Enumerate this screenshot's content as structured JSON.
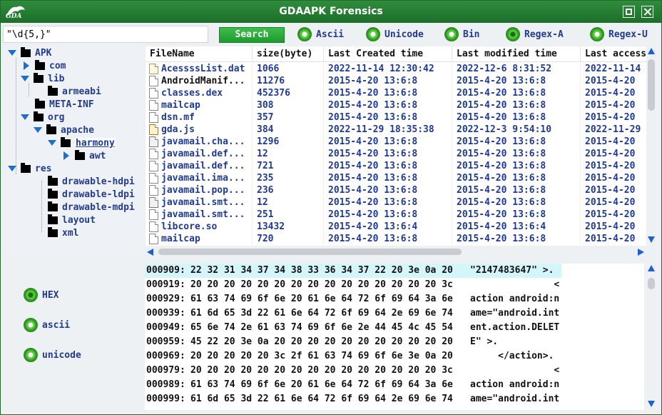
{
  "window": {
    "title": "GDAAPK Forensics",
    "logo_text": "GDA"
  },
  "search": {
    "value": "\"\\d{5,}\"",
    "button_label": "Search"
  },
  "encodings": [
    {
      "label": "Ascii",
      "checked": false
    },
    {
      "label": "Unicode",
      "checked": false
    },
    {
      "label": "Bin",
      "checked": false
    },
    {
      "label": "Regex-A",
      "checked": true
    },
    {
      "label": "Regex-U",
      "checked": false
    }
  ],
  "tree": {
    "apk": "APK",
    "com": "com",
    "lib": "lib",
    "armeabi": "armeabi",
    "meta_inf": "META-INF",
    "org": "org",
    "apache": "apache",
    "harmony": "harmony",
    "awt": "awt",
    "res": "res",
    "drawable_hdpi": "drawable-hdpi",
    "drawable_ldpi": "drawable-ldpi",
    "drawable_mdpi": "drawable-mdpi",
    "layout": "layout",
    "xml": "xml"
  },
  "filelist": {
    "headers": [
      "FileName",
      "size(byte)",
      "Last Created time",
      "Last modified time",
      "Last access"
    ],
    "rows": [
      [
        "AcessssList.dat",
        "1066",
        "2022-11-14 12:30:42",
        "2022-12-6 8:31:52",
        "2022-11-14"
      ],
      [
        "AndroidManif...",
        "11276",
        "2015-4-20 13:6:8",
        "2015-4-20 13:6:8",
        "2015-4-20"
      ],
      [
        "classes.dex",
        "452376",
        "2015-4-20 13:6:8",
        "2015-4-20 13:6:8",
        "2015-4-20"
      ],
      [
        "mailcap",
        "308",
        "2015-4-20 13:6:8",
        "2015-4-20 13:6:8",
        "2015-4-20"
      ],
      [
        "dsn.mf",
        "357",
        "2015-4-20 13:6:8",
        "2015-4-20 13:6:8",
        "2015-4-20"
      ],
      [
        "gda.js",
        "384",
        "2022-11-29 18:35:38",
        "2022-12-3 9:54:10",
        "2022-11-29"
      ],
      [
        "javamail.cha...",
        "1296",
        "2015-4-20 13:6:8",
        "2015-4-20 13:6:8",
        "2015-4-20"
      ],
      [
        "javamail.def...",
        "12",
        "2015-4-20 13:6:8",
        "2015-4-20 13:6:8",
        "2015-4-20"
      ],
      [
        "javamail.def...",
        "721",
        "2015-4-20 13:6:8",
        "2015-4-20 13:6:8",
        "2015-4-20"
      ],
      [
        "javamail.ima...",
        "235",
        "2015-4-20 13:6:8",
        "2015-4-20 13:6:8",
        "2015-4-20"
      ],
      [
        "javamail.pop...",
        "236",
        "2015-4-20 13:6:8",
        "2015-4-20 13:6:8",
        "2015-4-20"
      ],
      [
        "javamail.smt...",
        "12",
        "2015-4-20 13:6:8",
        "2015-4-20 13:6:8",
        "2015-4-20"
      ],
      [
        "javamail.smt...",
        "251",
        "2015-4-20 13:6:8",
        "2015-4-20 13:6:8",
        "2015-4-20"
      ],
      [
        "libcore.so",
        "13432",
        "2015-4-20 13:6:4",
        "2015-4-20 13:6:4",
        "2015-4-20"
      ],
      [
        "mailcap",
        "720",
        "2015-4-20 13:6:8",
        "2015-4-20 13:6:8",
        "2015-4-20"
      ]
    ],
    "row_icons": [
      "dat",
      "xml",
      "file",
      "file",
      "file",
      "js",
      "cfg",
      "file",
      "file",
      "file",
      "file",
      "cfg",
      "file",
      "file",
      "file"
    ]
  },
  "modes": [
    {
      "label": "HEX",
      "checked": true
    },
    {
      "label": "ascii",
      "checked": false
    },
    {
      "label": "unicode",
      "checked": false
    }
  ],
  "hex": {
    "rows": [
      {
        "offset": "000909:",
        "bytes": "22 32 31 34 37 34 38 33 36 34 37 22 20 3e 0a 20",
        "ascii": "\"2147483647\" >.",
        "highlight": true
      },
      {
        "offset": "000919:",
        "bytes": "20 20 20 20 20 20 20 20 20 20 20 20 20 20 20 3c",
        "ascii": "               <",
        "highlight": false
      },
      {
        "offset": "000929:",
        "bytes": "61 63 74 69 6f 6e 20 61 6e 64 72 6f 69 64 3a 6e",
        "ascii": "action android:n",
        "highlight": false
      },
      {
        "offset": "000939:",
        "bytes": "61 6d 65 3d 22 61 6e 64 72 6f 69 64 2e 69 6e 74",
        "ascii": "ame=\"android.int",
        "highlight": false
      },
      {
        "offset": "000949:",
        "bytes": "65 6e 74 2e 61 63 74 69 6f 6e 2e 44 45 4c 45 54",
        "ascii": "ent.action.DELET",
        "highlight": false
      },
      {
        "offset": "000959:",
        "bytes": "45 22 20 3e 0a 20 20 20 20 20 20 20 20 20 20 20",
        "ascii": "E\" >.",
        "highlight": false
      },
      {
        "offset": "000969:",
        "bytes": "20 20 20 20 20 3c 2f 61 63 74 69 6f 6e 3e 0a 20",
        "ascii": "     </action>.",
        "highlight": false
      },
      {
        "offset": "000979:",
        "bytes": "20 20 20 20 20 20 20 20 20 20 20 20 20 20 20 3c",
        "ascii": "               <",
        "highlight": false
      },
      {
        "offset": "000989:",
        "bytes": "61 63 74 69 6f 6e 20 61 6e 64 72 6f 69 64 3a 6e",
        "ascii": "action android:n",
        "highlight": false
      },
      {
        "offset": "000999:",
        "bytes": "61 6d 65 3d 22 61 6e 64 72 6f 69 64 2e 69 6e 74",
        "ascii": "ame=\"android.int",
        "highlight": false
      }
    ]
  },
  "colors": {
    "title_bar": "#1d6e2a",
    "accent_green": "#2e9a22",
    "link_blue": "#1f3a95",
    "highlight": "#d4f5f9"
  }
}
